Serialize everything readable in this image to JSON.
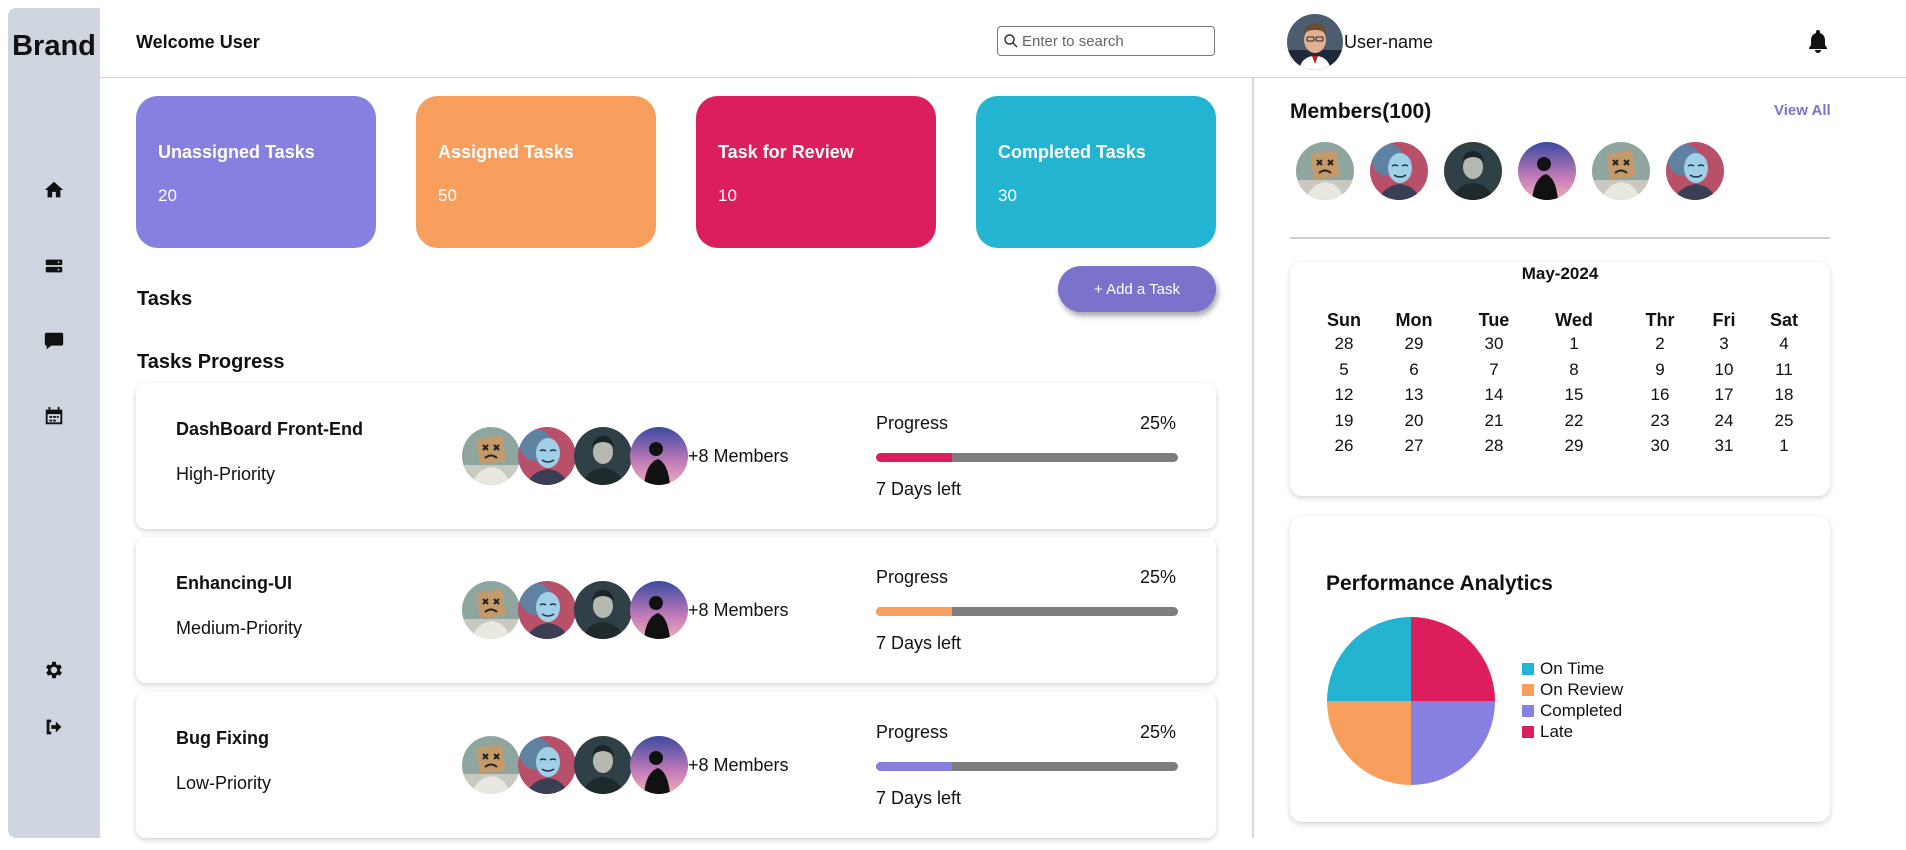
{
  "sidebar": {
    "brand": "Brand",
    "nav": [
      {
        "name": "home-icon"
      },
      {
        "name": "server-icon"
      },
      {
        "name": "chat-icon"
      },
      {
        "name": "calendar-icon"
      }
    ],
    "bottom": [
      {
        "name": "gear-icon"
      },
      {
        "name": "logout-icon"
      }
    ]
  },
  "header": {
    "welcome": "Welcome User",
    "search_placeholder": "Enter to search",
    "username": "User-name",
    "notification_icon": "bell-icon"
  },
  "stats": [
    {
      "title": "Unassigned Tasks",
      "value": "20",
      "color": "#8780e0"
    },
    {
      "title": "Assigned Tasks",
      "value": "50",
      "color": "#f89f5e"
    },
    {
      "title": "Task for Review",
      "value": "10",
      "color": "#dc1e5c"
    },
    {
      "title": "Completed Tasks",
      "value": "30",
      "color": "#22b4d0"
    }
  ],
  "tasks_section": {
    "title": "Tasks",
    "add_button": "+ Add a Task",
    "progress_title": "Tasks Progress"
  },
  "tasks": [
    {
      "name": "DashBoard Front-End",
      "priority": "High-Priority",
      "members": "+8 Members",
      "progress_label": "Progress",
      "progress_value": "25%",
      "progress": 0.25,
      "days_left": "7 Days left",
      "bar_color": "#dc1e5c"
    },
    {
      "name": "Enhancing-UI",
      "priority": "Medium-Priority",
      "members": "+8 Members",
      "progress_label": "Progress",
      "progress_value": "25%",
      "progress": 0.25,
      "days_left": "7 Days left",
      "bar_color": "#f89f5e"
    },
    {
      "name": "Bug Fixing",
      "priority": "Low-Priority",
      "members": "+8 Members",
      "progress_label": "Progress",
      "progress_value": "25%",
      "progress": 0.25,
      "days_left": "7 Days left",
      "bar_color": "#8780e0"
    }
  ],
  "members": {
    "title": "Members(100)",
    "view_all": "View All"
  },
  "calendar": {
    "title": "May-2024",
    "weekdays": [
      "Sun",
      "Mon",
      "Tue",
      "Wed",
      "Thr",
      "Fri",
      "Sat"
    ],
    "weeks": [
      [
        "28",
        "29",
        "30",
        "1",
        "2",
        "3",
        "4"
      ],
      [
        "5",
        "6",
        "7",
        "8",
        "9",
        "10",
        "11"
      ],
      [
        "12",
        "13",
        "14",
        "15",
        "16",
        "17",
        "18"
      ],
      [
        "19",
        "20",
        "21",
        "22",
        "23",
        "24",
        "25"
      ],
      [
        "26",
        "27",
        "28",
        "29",
        "30",
        "31",
        "1"
      ]
    ]
  },
  "analytics": {
    "title": "Performance Analytics"
  },
  "chart_data": {
    "type": "pie",
    "labels": [
      "On Time",
      "On Review",
      "Completed",
      "Late"
    ],
    "values": [
      25,
      25,
      25,
      25
    ],
    "colors": [
      "#22b4d0",
      "#f89f5e",
      "#8780e0",
      "#dc1e5c"
    ],
    "legend": "right"
  }
}
